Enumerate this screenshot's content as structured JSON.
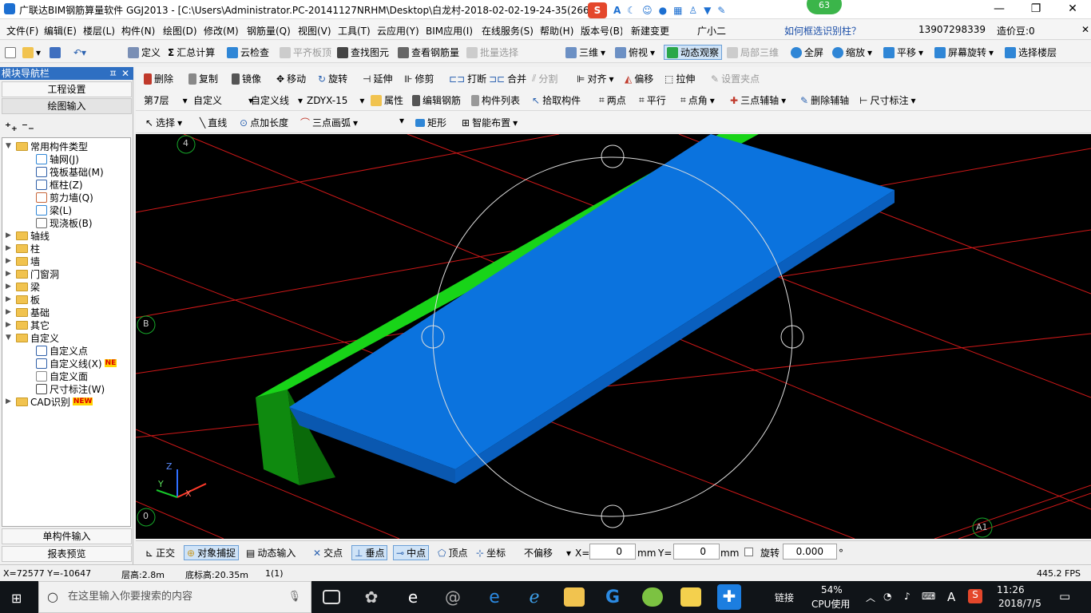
{
  "window": {
    "title": "广联达BIM钢筋算量软件 GGJ2013 - [C:\\Users\\Administrator.PC-20141127NRHM\\Desktop\\白龙村-2018-02-02-19-24-35(2666版).GGJ12]",
    "badge_number": "63"
  },
  "menu": {
    "items": [
      "文件(F)",
      "编辑(E)",
      "楼层(L)",
      "构件(N)",
      "绘图(D)",
      "修改(M)",
      "钢筋量(Q)",
      "视图(V)",
      "工具(T)",
      "云应用(Y)",
      "BIM应用(I)",
      "在线服务(S)",
      "帮助(H)",
      "版本号(B)",
      "新建变更",
      "广小二"
    ],
    "help_link": "如何框选识别柱？",
    "phone": "13907298339",
    "bean": "造价豆:0"
  },
  "toolbar1": {
    "items": [
      "定义",
      "汇总计算",
      "云检查",
      "平齐板顶",
      "查找图元",
      "查看钢筋量",
      "批量选择",
      "三维",
      "俯视",
      "动态观察",
      "局部三维",
      "全屏",
      "缩放",
      "平移",
      "屏幕旋转",
      "选择楼层"
    ]
  },
  "toolbar2": {
    "items": [
      "删除",
      "复制",
      "镜像",
      "移动",
      "旋转",
      "延伸",
      "修剪",
      "打断",
      "合并",
      "分割",
      "对齐",
      "偏移",
      "拉伸",
      "设置夹点"
    ]
  },
  "toolbar3": {
    "floor": "第7层",
    "category": "自定义",
    "type": "自定义线",
    "element": "ZDYX-15",
    "items": [
      "属性",
      "编辑钢筋",
      "构件列表",
      "拾取构件",
      "两点",
      "平行",
      "点角",
      "三点辅轴",
      "删除辅轴",
      "尺寸标注"
    ]
  },
  "toolbar4": {
    "items": [
      "选择",
      "直线",
      "点加长度",
      "三点画弧",
      "矩形",
      "智能布置"
    ]
  },
  "nav": {
    "title": "模块导航栏",
    "project_settings": "工程设置",
    "drawing_input": "绘图输入",
    "single_input": "单构件输入",
    "report_preview": "报表预览",
    "tree": [
      {
        "label": "常用构件类型",
        "level": 0,
        "type": "folder-open"
      },
      {
        "label": "轴网(J)",
        "level": 1,
        "type": "grid"
      },
      {
        "label": "筏板基础(M)",
        "level": 1,
        "type": "raft"
      },
      {
        "label": "框柱(Z)",
        "level": 1,
        "type": "column"
      },
      {
        "label": "剪力墙(Q)",
        "level": 1,
        "type": "wall"
      },
      {
        "label": "梁(L)",
        "level": 1,
        "type": "beam"
      },
      {
        "label": "现浇板(B)",
        "level": 1,
        "type": "slab"
      },
      {
        "label": "轴线",
        "level": 0,
        "type": "folder"
      },
      {
        "label": "柱",
        "level": 0,
        "type": "folder"
      },
      {
        "label": "墙",
        "level": 0,
        "type": "folder"
      },
      {
        "label": "门窗洞",
        "level": 0,
        "type": "folder"
      },
      {
        "label": "梁",
        "level": 0,
        "type": "folder"
      },
      {
        "label": "板",
        "level": 0,
        "type": "folder"
      },
      {
        "label": "基础",
        "level": 0,
        "type": "folder"
      },
      {
        "label": "其它",
        "level": 0,
        "type": "folder"
      },
      {
        "label": "自定义",
        "level": 0,
        "type": "folder-open"
      },
      {
        "label": "自定义点",
        "level": 1,
        "type": "point"
      },
      {
        "label": "自定义线(X)",
        "level": 1,
        "type": "line",
        "badge": "NE"
      },
      {
        "label": "自定义面",
        "level": 1,
        "type": "face"
      },
      {
        "label": "尺寸标注(W)",
        "level": 1,
        "type": "dim"
      },
      {
        "label": "CAD识别",
        "level": 0,
        "type": "folder",
        "badge": "NEW"
      }
    ]
  },
  "canvas": {
    "axis_labels": [
      "4",
      "B",
      "0",
      "A1"
    ],
    "axes": {
      "x": "X",
      "y": "Y",
      "z": "Z"
    },
    "colors": {
      "background": "#000000",
      "grid": "#ff0000",
      "blue_face": "#0b73de",
      "green_face": "#18d418"
    }
  },
  "bottombar": {
    "ortho": "正交",
    "snap": "对象捕捉",
    "dynamic_input": "动态输入",
    "snaps": [
      "交点",
      "垂点",
      "中点",
      "顶点",
      "坐标"
    ],
    "offset_mode": "不偏移",
    "x_label": "X=",
    "x_value": "0",
    "unit": "mm",
    "y_label": "Y=",
    "y_value": "0",
    "rotate_label": "旋转",
    "rotate_value": "0.000",
    "degree": "°"
  },
  "status": {
    "coords": "X=72577 Y=-10647",
    "floor_height": "层高:2.8m",
    "base_height": "底标高:20.35m",
    "count": "1(1)",
    "fps": "445.2 FPS"
  },
  "taskbar": {
    "search_placeholder": "在这里输入你要搜索的内容",
    "link": "链接",
    "cpu_pct": "54%",
    "cpu_label": "CPU使用",
    "lang": "A",
    "time": "11:26",
    "date": "2018/7/5"
  }
}
